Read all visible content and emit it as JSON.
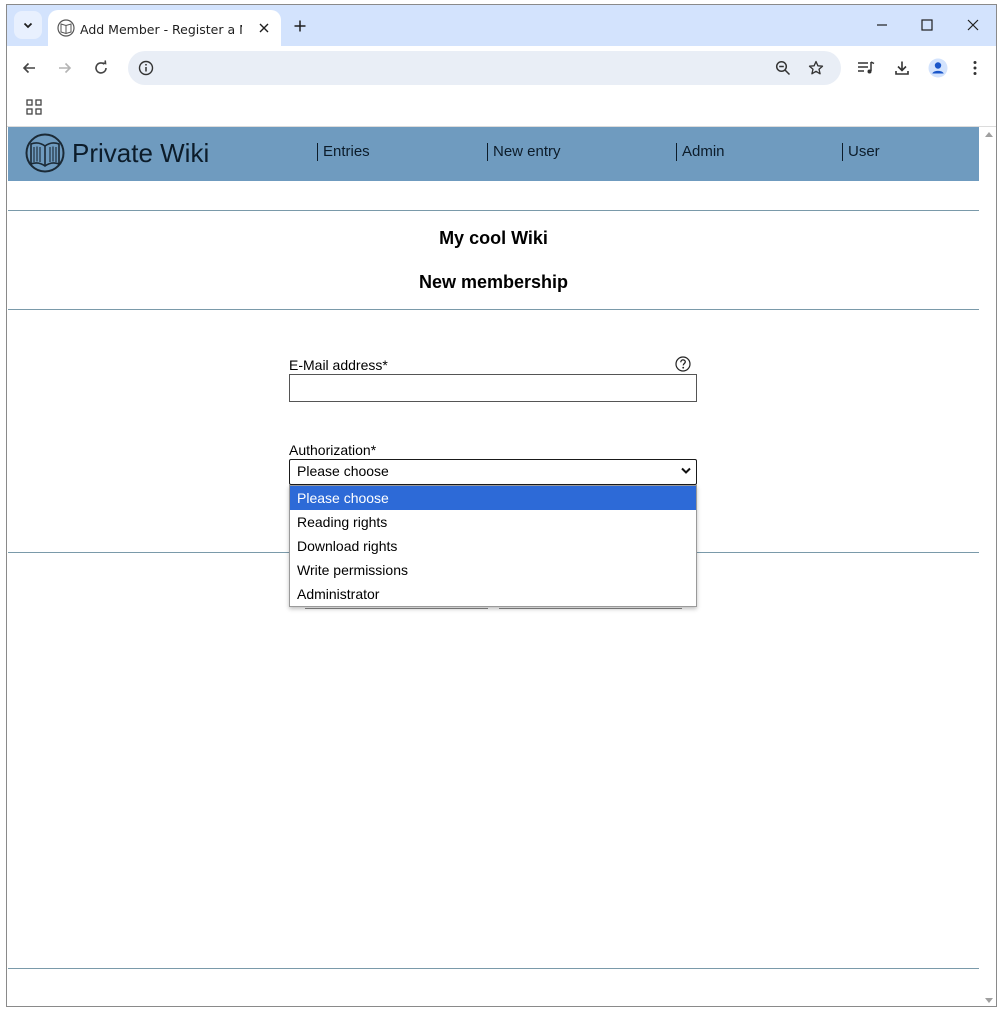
{
  "browser": {
    "tab_title": "Add Member - Register a New T",
    "address": ""
  },
  "site": {
    "title": "Private Wiki",
    "nav": [
      {
        "label": "Entries"
      },
      {
        "label": "New entry"
      },
      {
        "label": "Admin"
      },
      {
        "label": "User"
      }
    ],
    "header_color": "#6f9bbf"
  },
  "page": {
    "wiki_name": "My cool Wiki",
    "heading": "New membership"
  },
  "form": {
    "email_label": "E-Mail address*",
    "email_value": "",
    "authorization_label": "Authorization*",
    "authorization_selected": "Please choose",
    "authorization_options": [
      {
        "label": "Please choose",
        "selected": true
      },
      {
        "label": "Reading rights",
        "selected": false
      },
      {
        "label": "Download rights",
        "selected": false
      },
      {
        "label": "Write permissions",
        "selected": false
      },
      {
        "label": "Administrator",
        "selected": false
      }
    ]
  },
  "icons": {
    "tab_search": "chevron-down-icon",
    "favicon": "book-icon",
    "close": "close-icon",
    "new_tab": "plus-icon",
    "minimize": "minimize-icon",
    "maximize": "maximize-icon",
    "window_close": "window-close-icon",
    "back": "back-arrow-icon",
    "forward": "forward-arrow-icon",
    "reload": "reload-icon",
    "info": "info-icon",
    "zoom": "zoom-out-icon",
    "bookmark": "star-icon",
    "media": "media-control-icon",
    "download": "download-icon",
    "profile": "profile-icon",
    "menu": "kebab-menu-icon",
    "apps": "apps-grid-icon",
    "help": "help-icon"
  },
  "colors": {
    "accent": "#2d6ad7",
    "tabstrip": "#d3e3fd"
  }
}
